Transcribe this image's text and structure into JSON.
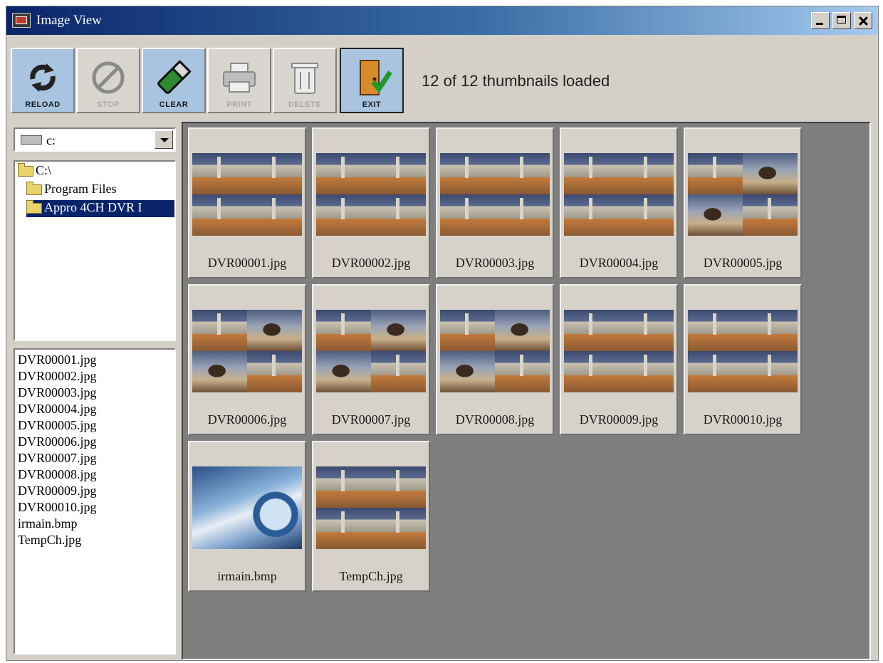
{
  "window": {
    "title": "Image View"
  },
  "toolbar": {
    "buttons": [
      {
        "id": "reload",
        "label": "RELOAD",
        "state": "active",
        "icon": "reload-arrows-icon"
      },
      {
        "id": "stop",
        "label": "STOP",
        "state": "disabled",
        "icon": "stop-circle-icon"
      },
      {
        "id": "clear",
        "label": "CLEAR",
        "state": "active",
        "icon": "eraser-icon"
      },
      {
        "id": "print",
        "label": "PRINT",
        "state": "disabled",
        "icon": "printer-icon"
      },
      {
        "id": "delete",
        "label": "DELETE",
        "state": "disabled",
        "icon": "trash-can-icon"
      },
      {
        "id": "exit",
        "label": "EXIT",
        "state": "active",
        "icon": "exit-door-icon"
      }
    ],
    "status": "12 of 12 thumbnails loaded"
  },
  "drive": {
    "selected": "c:",
    "icon": "hard-drive-icon"
  },
  "folders": [
    {
      "label": "C:\\",
      "selected": false
    },
    {
      "label": "Program Files",
      "selected": false
    },
    {
      "label": "Appro 4CH DVR I",
      "selected": true
    }
  ],
  "files": [
    "DVR00001.jpg",
    "DVR00002.jpg",
    "DVR00003.jpg",
    "DVR00004.jpg",
    "DVR00005.jpg",
    "DVR00006.jpg",
    "DVR00007.jpg",
    "DVR00008.jpg",
    "DVR00009.jpg",
    "DVR00010.jpg",
    "irmain.bmp",
    "TempCh.jpg"
  ],
  "thumbnails": [
    {
      "name": "DVR00001.jpg",
      "kind": "office"
    },
    {
      "name": "DVR00002.jpg",
      "kind": "office"
    },
    {
      "name": "DVR00003.jpg",
      "kind": "office"
    },
    {
      "name": "DVR00004.jpg",
      "kind": "office"
    },
    {
      "name": "DVR00005.jpg",
      "kind": "person"
    },
    {
      "name": "DVR00006.jpg",
      "kind": "person"
    },
    {
      "name": "DVR00007.jpg",
      "kind": "person"
    },
    {
      "name": "DVR00008.jpg",
      "kind": "person"
    },
    {
      "name": "DVR00009.jpg",
      "kind": "office"
    },
    {
      "name": "DVR00010.jpg",
      "kind": "office"
    },
    {
      "name": "irmain.bmp",
      "kind": "disk"
    },
    {
      "name": "TempCh.jpg",
      "kind": "office"
    }
  ],
  "colors": {
    "title_start": "#0a246a",
    "title_end": "#a6caf0",
    "selection": "#0a246a",
    "thumb_area": "#7e7e7e",
    "face": "#d4d0c8"
  }
}
